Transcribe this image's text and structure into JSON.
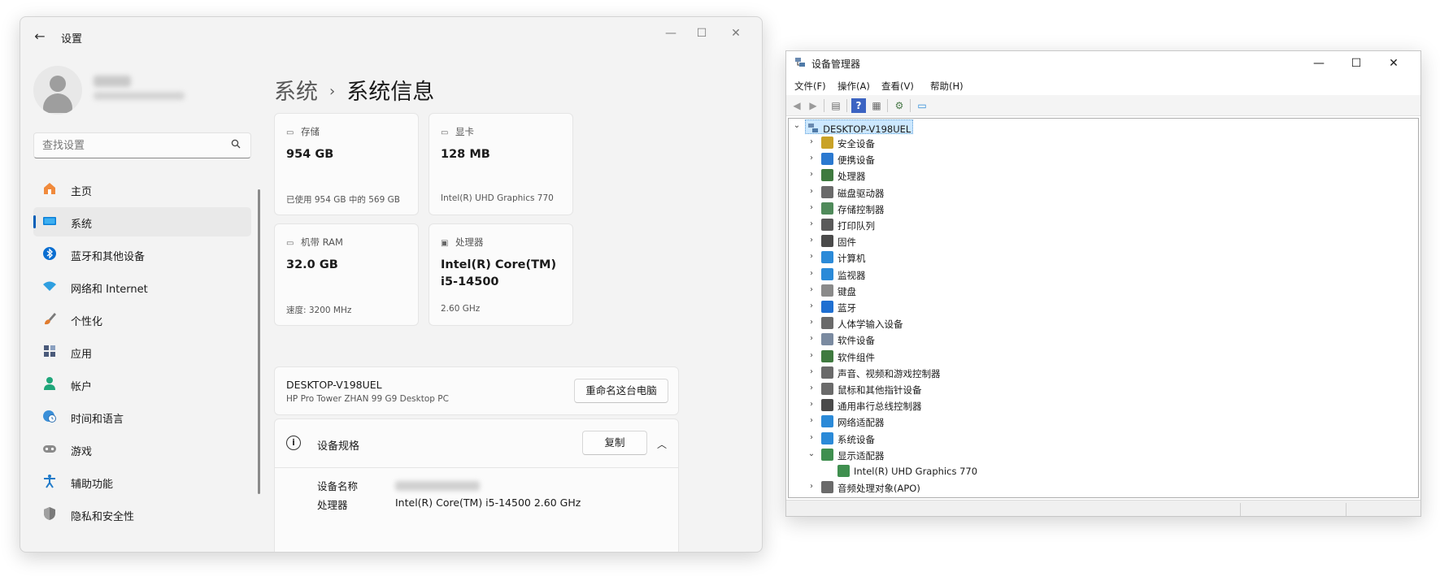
{
  "settings": {
    "title": "设置",
    "back_icon": "arrow-left-icon",
    "search_placeholder": "查找设置",
    "nav": [
      {
        "label": "主页",
        "icon": "home-icon",
        "color": "#e66a2c"
      },
      {
        "label": "系统",
        "icon": "system-icon",
        "color": "#0078d4",
        "active": true
      },
      {
        "label": "蓝牙和其他设备",
        "icon": "bluetooth-icon",
        "color": "#0078d4"
      },
      {
        "label": "网络和 Internet",
        "icon": "wifi-icon",
        "color": "#2f9fe0"
      },
      {
        "label": "个性化",
        "icon": "brush-icon",
        "color": "#d27a2e"
      },
      {
        "label": "应用",
        "icon": "apps-icon",
        "color": "#4a5a7a"
      },
      {
        "label": "帐户",
        "icon": "account-icon",
        "color": "#1fa67a"
      },
      {
        "label": "时间和语言",
        "icon": "clock-globe-icon",
        "color": "#2d88d8"
      },
      {
        "label": "游戏",
        "icon": "gamepad-icon",
        "color": "#6b6b6b"
      },
      {
        "label": "辅助功能",
        "icon": "accessibility-icon",
        "color": "#1f7ac9"
      },
      {
        "label": "隐私和安全性",
        "icon": "shield-icon",
        "color": "#6e6e6e"
      }
    ],
    "breadcrumb": {
      "parent": "系统",
      "separator": "›",
      "current": "系统信息"
    },
    "cards": [
      {
        "label": "存储",
        "icon": "storage-icon",
        "value": "954 GB",
        "sub": "已使用 954 GB 中的 569 GB"
      },
      {
        "label": "显卡",
        "icon": "gpu-icon",
        "value": "128 MB",
        "sub": "Intel(R) UHD Graphics 770"
      },
      {
        "label": "机带 RAM",
        "icon": "ram-icon",
        "value": "32.0 GB",
        "sub": "速度: 3200 MHz"
      },
      {
        "label": "处理器",
        "icon": "cpu-icon",
        "value_line1": "Intel(R) Core(TM)",
        "value_line2": "i5-14500",
        "sub": "2.60 GHz"
      }
    ],
    "pc": {
      "name": "DESKTOP-V198UEL",
      "model": "HP Pro Tower ZHAN 99 G9 Desktop PC",
      "rename_label": "重命名这台电脑"
    },
    "spec": {
      "title": "设备规格",
      "copy_label": "复制",
      "rows": [
        {
          "label": "设备名称",
          "value": ""
        },
        {
          "label": "处理器",
          "value": "Intel(R) Core(TM) i5-14500   2.60 GHz"
        }
      ]
    }
  },
  "device_manager": {
    "title": "设备管理器",
    "menus": [
      "文件(F)",
      "操作(A)",
      "查看(V)",
      "帮助(H)"
    ],
    "root": "DESKTOP-V198UEL",
    "categories": [
      {
        "label": "安全设备",
        "icon": "security-device-icon",
        "color": "#c9a227"
      },
      {
        "label": "便携设备",
        "icon": "portable-device-icon",
        "color": "#2b79d0"
      },
      {
        "label": "处理器",
        "icon": "processor-icon",
        "color": "#3f7a3f"
      },
      {
        "label": "磁盘驱动器",
        "icon": "disk-drive-icon",
        "color": "#6a6a6a"
      },
      {
        "label": "存储控制器",
        "icon": "storage-controller-icon",
        "color": "#4f8a5a"
      },
      {
        "label": "打印队列",
        "icon": "printer-icon",
        "color": "#5a5a5a"
      },
      {
        "label": "固件",
        "icon": "firmware-icon",
        "color": "#4a4a4a"
      },
      {
        "label": "计算机",
        "icon": "computer-icon",
        "color": "#2b8ad8"
      },
      {
        "label": "监视器",
        "icon": "monitor-icon",
        "color": "#2b8ad8"
      },
      {
        "label": "键盘",
        "icon": "keyboard-icon",
        "color": "#8a8a8a"
      },
      {
        "label": "蓝牙",
        "icon": "bluetooth-icon",
        "color": "#1f6fd1"
      },
      {
        "label": "人体学输入设备",
        "icon": "hid-icon",
        "color": "#6a6a6a"
      },
      {
        "label": "软件设备",
        "icon": "software-device-icon",
        "color": "#7a8aa0"
      },
      {
        "label": "软件组件",
        "icon": "software-component-icon",
        "color": "#3f7a3f"
      },
      {
        "label": "声音、视频和游戏控制器",
        "icon": "speaker-icon",
        "color": "#6a6a6a"
      },
      {
        "label": "鼠标和其他指针设备",
        "icon": "mouse-icon",
        "color": "#6a6a6a"
      },
      {
        "label": "通用串行总线控制器",
        "icon": "usb-icon",
        "color": "#4a4a4a"
      },
      {
        "label": "网络适配器",
        "icon": "network-adapter-icon",
        "color": "#2b8ad8"
      },
      {
        "label": "系统设备",
        "icon": "system-device-icon",
        "color": "#2b8ad8"
      },
      {
        "label": "显示适配器",
        "icon": "display-adapter-icon",
        "color": "#3f8f4f",
        "expanded": true
      },
      {
        "label": "Intel(R) UHD Graphics 770",
        "icon": "display-adapter-icon",
        "color": "#3f8f4f",
        "child": true
      },
      {
        "label": "音频处理对象(APO)",
        "icon": "speaker-icon",
        "color": "#6a6a6a"
      }
    ]
  }
}
